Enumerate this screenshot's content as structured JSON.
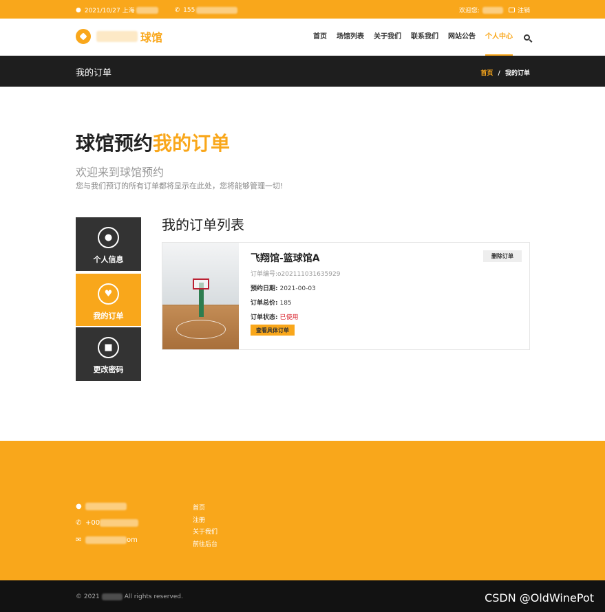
{
  "topbar": {
    "date_location": "2021/10/27 上海",
    "phone": "155",
    "welcome": "欢迎您:",
    "logout": "注销"
  },
  "header": {
    "logo_text": "球馆",
    "nav": [
      "首页",
      "场馆列表",
      "关于我们",
      "联系我们",
      "网站公告",
      "个人中心"
    ],
    "active_nav": "个人中心"
  },
  "titlebar": {
    "page_title": "我的订单",
    "breadcrumb_home": "首页",
    "breadcrumb_sep": "/",
    "breadcrumb_current": "我的订单"
  },
  "hero": {
    "title_main": "球馆预约",
    "title_highlight": "我的订单",
    "subtitle": "欢迎来到球馆预约",
    "description": "您与我们预订的所有订单都将显示在此处，您将能够管理一切!"
  },
  "sidebar": {
    "items": [
      {
        "label": "个人信息",
        "icon": "user-icon"
      },
      {
        "label": "我的订单",
        "icon": "heart-icon"
      },
      {
        "label": "更改密码",
        "icon": "lock-icon"
      }
    ]
  },
  "orders": {
    "list_title": "我的订单列表",
    "items": [
      {
        "name": "飞翔馆-篮球馆A",
        "order_no": "订单编号:o202111031635929",
        "date_label": "预约日期:",
        "date": "2021-00-03",
        "total_label": "订单总价:",
        "total": "185",
        "status_label": "订单状态:",
        "status": "已使用",
        "view_button": "查看具体订单",
        "delete_button": "删除订单"
      }
    ]
  },
  "footer": {
    "phone_prefix": "+00",
    "email_suffix": "om",
    "links": [
      "首页",
      "注册",
      "关于我们",
      "前往后台"
    ],
    "copyright_prefix": "© 2021",
    "copyright_suffix": "All rights reserved.",
    "watermark": "CSDN @OldWinePot"
  },
  "colors": {
    "accent": "#f9a71b",
    "dark": "#1e1e1e",
    "status_red": "#d9232d"
  }
}
